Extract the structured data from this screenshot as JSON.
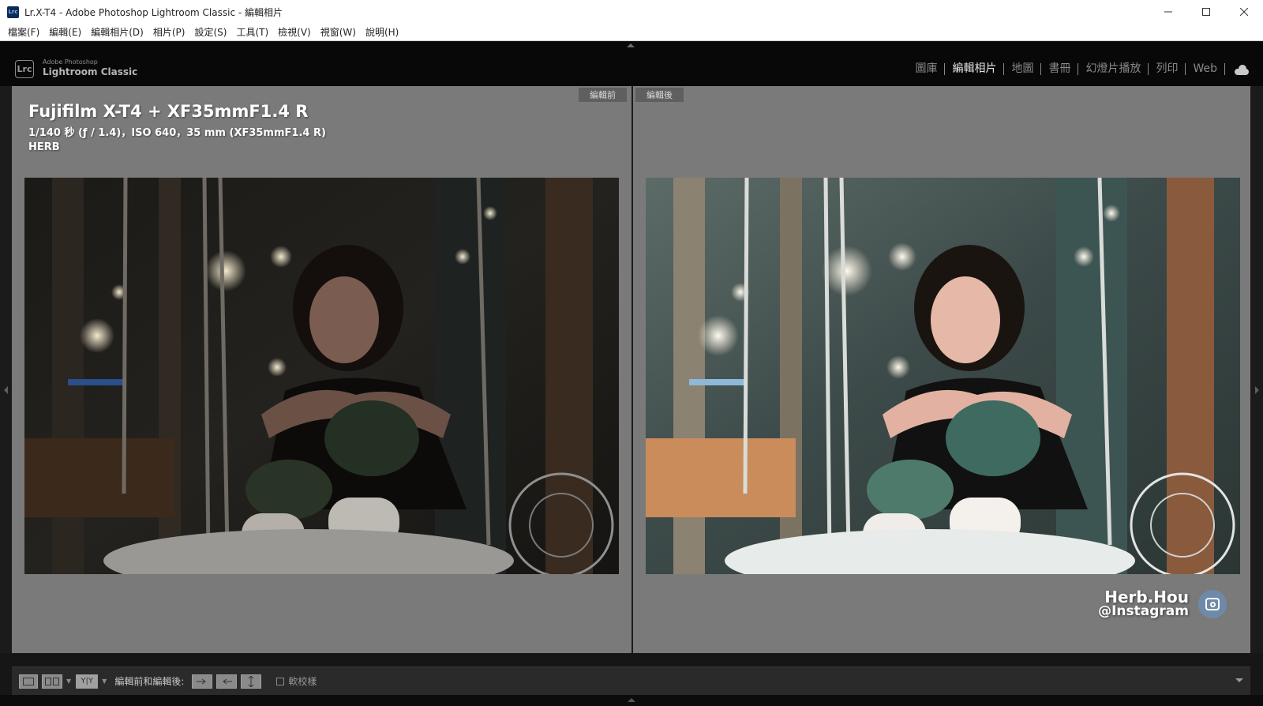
{
  "window": {
    "app_icon": "Lrc",
    "title": "Lr.X-T4 - Adobe Photoshop Lightroom Classic - 編輯相片",
    "controls": [
      "minimize-icon",
      "maximize-icon",
      "close-icon"
    ]
  },
  "menu": {
    "items": [
      "檔案(F)",
      "編輯(E)",
      "編輯相片(D)",
      "相片(P)",
      "設定(S)",
      "工具(T)",
      "檢視(V)",
      "視窗(W)",
      "說明(H)"
    ]
  },
  "brand": {
    "badge": "Lrc",
    "small": "Adobe Photoshop",
    "big": "Lightroom Classic"
  },
  "modules": {
    "items": [
      "圖庫",
      "編輯相片",
      "地圖",
      "書冊",
      "幻燈片播放",
      "列印",
      "Web"
    ],
    "active": "編輯相片"
  },
  "compare": {
    "before_label": "編輯前",
    "after_label": "編輯後"
  },
  "info": {
    "title": "Fujifilm X-T4 + XF35mmF1.4 R",
    "exif": "1/140 秒 (ƒ / 1.4)，ISO 640，35 mm (XF35mmF1.4 R)",
    "author": "HERB"
  },
  "watermark": {
    "name": "Herb.Hou",
    "handle": "@Instagram",
    "icon": "instagram-icon"
  },
  "toolbar": {
    "view_label": "編輯前和編輯後:",
    "before_after_mode": "Y|Y",
    "soft_proof_label": "軟校樣",
    "soft_proof_checked": false
  }
}
